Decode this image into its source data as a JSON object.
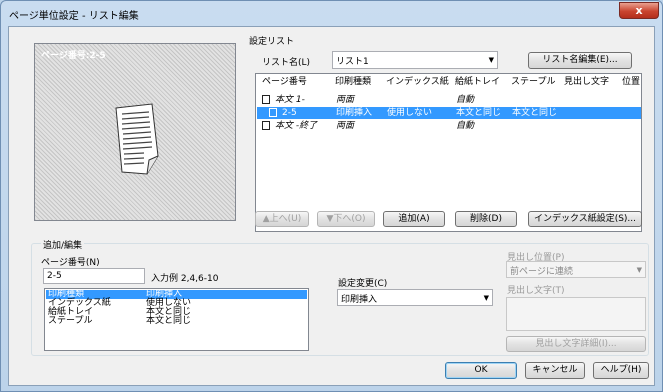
{
  "window": {
    "title": "ページ単位設定 - リスト編集",
    "close_glyph": "x"
  },
  "preview": {
    "label": "ページ番号:2-5"
  },
  "settings_list": {
    "group_label": "設定リスト",
    "list_name_label": "リスト名(L)",
    "list_name_value": "リスト1",
    "edit_list_name_button": "リスト名編集(E)...",
    "columns": [
      "ページ番号",
      "印刷種類",
      "インデックス紙",
      "給紙トレイ",
      "ステープル",
      "見出し文字",
      "位置"
    ],
    "rows": [
      {
        "page": "本文 1-",
        "print_type": "両面",
        "index_paper": "",
        "tray": "自動",
        "staple": "",
        "selected": false
      },
      {
        "page": "2-5",
        "print_type": "印刷挿入",
        "index_paper": "使用しない",
        "tray": "本文と同じ",
        "staple": "本文と同じ",
        "selected": true
      },
      {
        "page": "本文 -終了",
        "print_type": "両面",
        "index_paper": "",
        "tray": "自動",
        "staple": "",
        "selected": false
      }
    ],
    "up_button": "▲上へ(U)",
    "down_button": "▼下へ(O)",
    "add_button": "追加(A)",
    "delete_button": "削除(D)",
    "index_settings_button": "インデックス紙設定(S)..."
  },
  "add_edit": {
    "group_label": "追加/編集",
    "page_number_label": "ページ番号(N)",
    "page_number_value": "2-5",
    "input_example": "入力例 2,4,6-10",
    "summary": [
      {
        "key": "印刷種類",
        "value": "印刷挿入"
      },
      {
        "key": "インデックス紙",
        "value": "使用しない"
      },
      {
        "key": "給紙トレイ",
        "value": "本文と同じ"
      },
      {
        "key": "ステープル",
        "value": "本文と同じ"
      }
    ],
    "change_setting_label": "設定変更(C)",
    "change_setting_value": "印刷挿入",
    "heading_position_label": "見出し位置(P)",
    "heading_position_value": "前ページに連続",
    "heading_text_label": "見出し文字(T)",
    "heading_text_value": "",
    "heading_detail_button": "見出し文字詳細(I)..."
  },
  "footer": {
    "ok": "OK",
    "cancel": "キャンセル",
    "help": "ヘルプ(H)"
  },
  "colors": {
    "selection": "#3399ff",
    "title_bar": "#bcd3ea",
    "close_button": "#c9442f"
  }
}
